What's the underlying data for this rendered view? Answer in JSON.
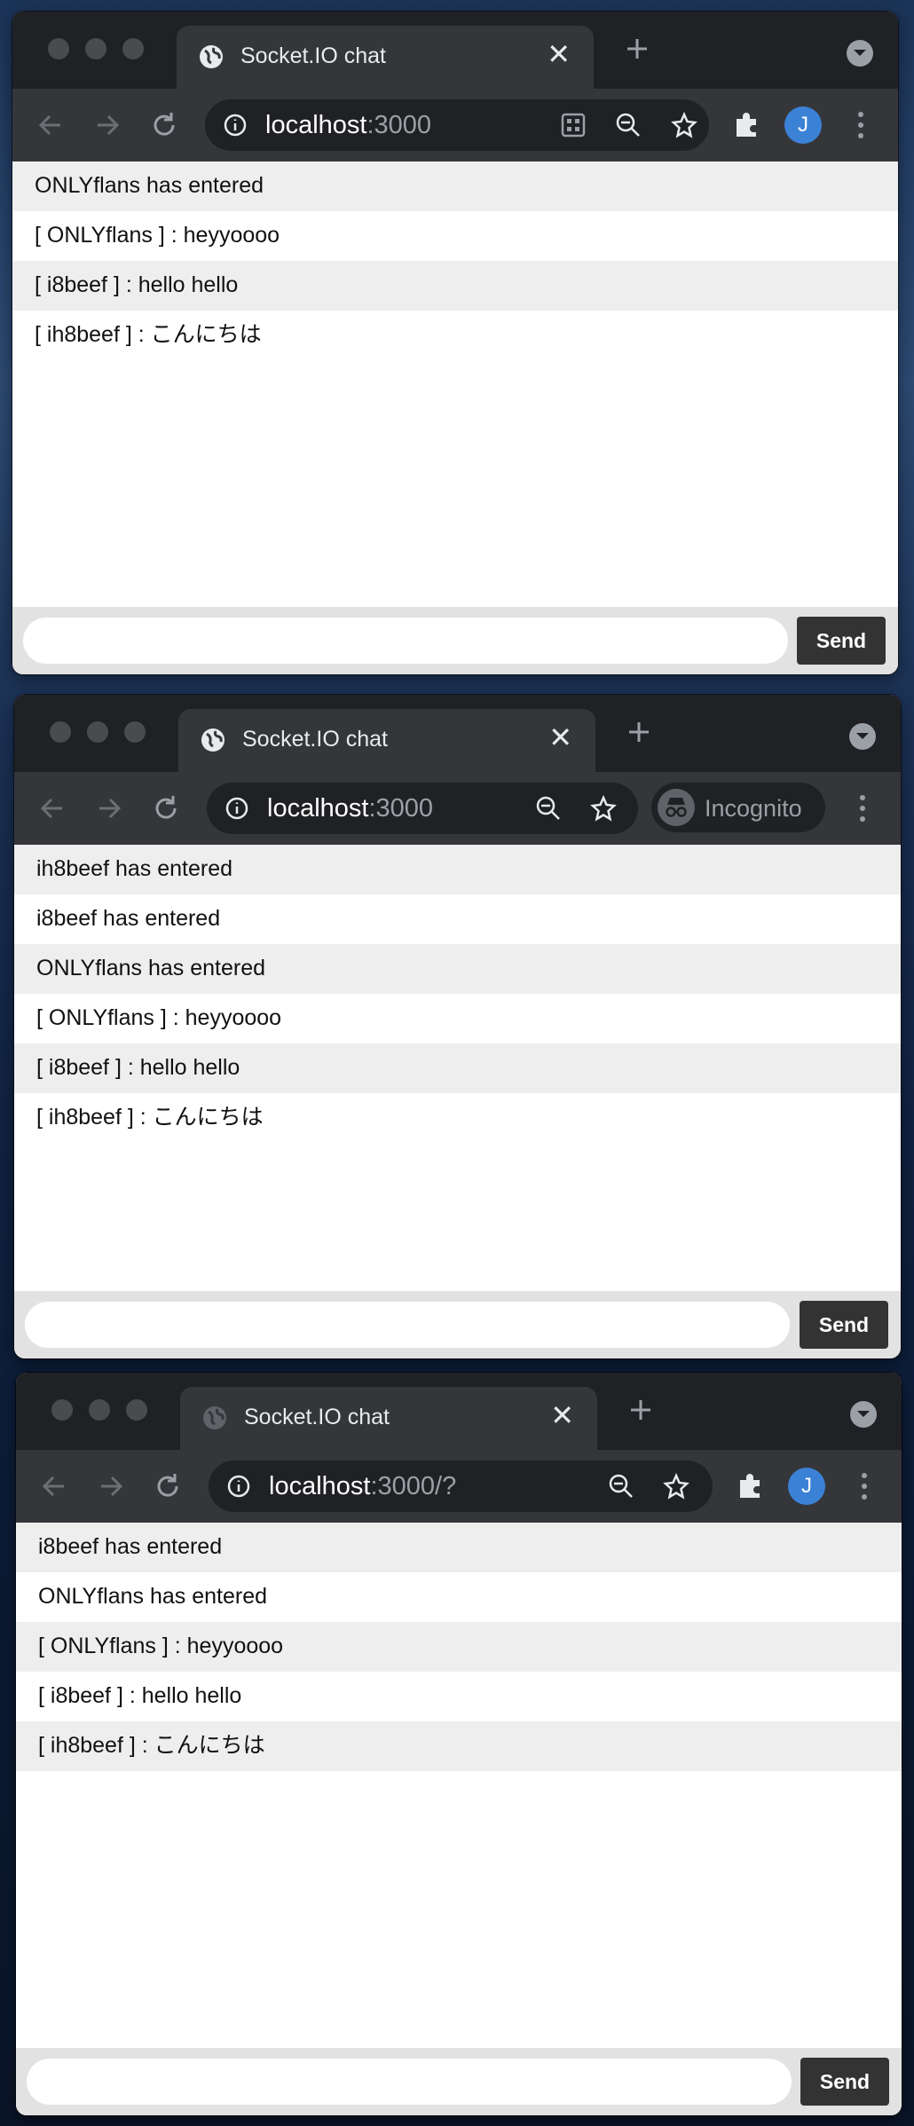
{
  "windows": [
    {
      "tab_title": "Socket.IO chat",
      "url_host": "localhost",
      "url_rest": ":3000",
      "incognito": false,
      "incognito_label": "",
      "avatar_letter": "J",
      "messages": [
        "ONLYflans has entered",
        "[ ONLYflans ] : heyyoooo",
        "[ i8beef ] : hello hello",
        "[ ih8beef ] : こんにちは"
      ],
      "send_label": "Send",
      "input_value": ""
    },
    {
      "tab_title": "Socket.IO chat",
      "url_host": "localhost",
      "url_rest": ":3000",
      "incognito": true,
      "incognito_label": "Incognito",
      "avatar_letter": "",
      "messages": [
        "ih8beef has entered",
        "i8beef has entered",
        "ONLYflans has entered",
        "[ ONLYflans ] : heyyoooo",
        "[ i8beef ] : hello hello",
        "[ ih8beef ] : こんにちは"
      ],
      "send_label": "Send",
      "input_value": ""
    },
    {
      "tab_title": "Socket.IO chat",
      "url_host": "localhost",
      "url_rest": ":3000/?",
      "incognito": false,
      "incognito_label": "",
      "avatar_letter": "J",
      "messages": [
        "i8beef has entered",
        "ONLYflans has entered",
        "[ ONLYflans ] : heyyoooo",
        "[ i8beef ] : hello hello",
        "[ ih8beef ] : こんにちは"
      ],
      "send_label": "Send",
      "input_value": ""
    }
  ],
  "icons": {
    "favicon": "globe-icon",
    "close": "close-icon",
    "new_tab": "plus-icon",
    "tab_search": "tab-search-icon",
    "back": "back-arrow-icon",
    "forward": "forward-arrow-icon",
    "reload": "reload-icon",
    "site_info": "info-icon",
    "qr": "qr-code-icon",
    "zoom": "zoom-out-icon",
    "bookmark": "star-icon",
    "extensions": "puzzle-icon",
    "menu": "kebab-menu-icon",
    "incognito": "incognito-icon"
  },
  "colors": {
    "chrome_dark": "#202124",
    "toolbar": "#35363a",
    "avatar": "#3b82d6",
    "send_button": "#333333",
    "row_alt": "#eeeeee"
  }
}
